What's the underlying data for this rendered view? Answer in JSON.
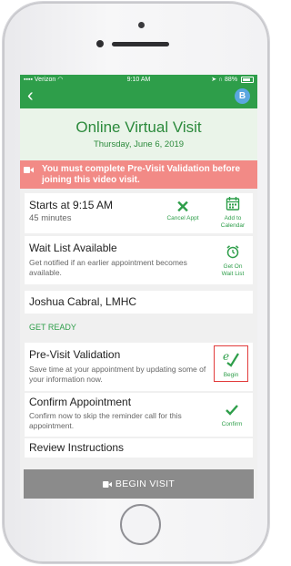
{
  "status_bar": {
    "carrier": "Verizon",
    "time": "9:10 AM",
    "battery": "88%"
  },
  "nav": {
    "back_glyph": "‹",
    "avatar_initial": "B"
  },
  "header": {
    "title": "Online Virtual Visit",
    "date": "Thursday, June 6, 2019"
  },
  "alert": {
    "text": "You must complete Pre-Visit Validation before joining this video visit.",
    "icon": "video-camera-icon"
  },
  "appointment": {
    "start": "Starts at 9:15 AM",
    "duration": "45 minutes",
    "cancel_label": "Cancel Appt",
    "add_calendar_label_1": "Add to",
    "add_calendar_label_2": "Calendar"
  },
  "waitlist": {
    "title": "Wait List Available",
    "desc": "Get notified if an earlier appointment becomes available.",
    "action_label_1": "Get On",
    "action_label_2": "Wait List"
  },
  "provider": {
    "name": "Joshua Cabral, LMHC"
  },
  "get_ready_label": "GET READY",
  "pre_visit": {
    "title": "Pre-Visit Validation",
    "desc": "Save time at your appointment by updating some of your information now.",
    "action_label": "Begin"
  },
  "confirm": {
    "title": "Confirm Appointment",
    "desc": "Confirm now to skip the reminder call for this appointment.",
    "action_label": "Confirm"
  },
  "instructions": {
    "title": "Review Instructions"
  },
  "begin_visit": {
    "label": "BEGIN VISIT"
  },
  "colors": {
    "brand_green": "#2e9e4a",
    "alert_red": "#f28a86",
    "highlight_red": "#e23c3c",
    "disabled_gray": "#8b8b8b"
  }
}
